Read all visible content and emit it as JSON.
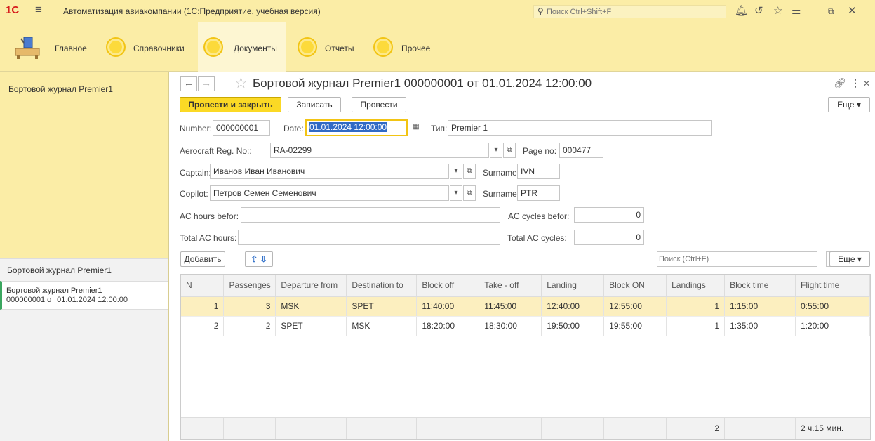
{
  "titlebar": {
    "logo": "1С",
    "app_title": "Автоматизация авиакомпании (1С:Предприятие, учебная версия)",
    "search_placeholder": "Поиск Ctrl+Shift+F"
  },
  "sections": [
    {
      "label": "Главное",
      "icon": "home-desk-icon"
    },
    {
      "label": "Справочники",
      "icon": "circle-icon"
    },
    {
      "label": "Документы",
      "icon": "circle-icon",
      "active": true
    },
    {
      "label": "Отчеты",
      "icon": "circle-icon"
    },
    {
      "label": "Прочее",
      "icon": "circle-icon"
    }
  ],
  "left_panel": {
    "top_item": "Бортовой журнал Premier1",
    "history_title": "Бортовой журнал Premier1",
    "history_item_line1": "Бортовой журнал Premier1",
    "history_item_line2": "000000001 от 01.01.2024 12:00:00"
  },
  "form": {
    "title": "Бортовой журнал Premier1 000000001 от 01.01.2024 12:00:00",
    "buttons": {
      "post_close": "Провести и закрыть",
      "write": "Записать",
      "post": "Провести",
      "more": "Еще ▾"
    },
    "fields": {
      "number_label": "Number:",
      "number": "000000001",
      "date_label": "Date:",
      "date": "01.01.2024 12:00:00",
      "type_label": "Тип:",
      "type": "Premier 1",
      "reg_label": "Aerocraft Reg. No::",
      "reg": "RA-02299",
      "page_label": "Page no:",
      "page": "000477",
      "captain_label": "Captain:",
      "captain": "Иванов Иван Иванович",
      "captain_surname_label": "Surname:",
      "captain_surname": "IVN",
      "copilot_label": "Copilot:",
      "copilot": "Петров Семен Семенович",
      "copilot_surname_label": "Surname:",
      "copilot_surname": "PTR",
      "ac_hours_label": "AC hours befor:",
      "ac_hours": "",
      "ac_cycles_label": "AC cycles befor:",
      "ac_cycles": "0",
      "total_hours_label": "Total AC hours:",
      "total_hours": "",
      "total_cycles_label": "Total AC cycles:",
      "total_cycles": "0"
    },
    "table_toolbar": {
      "add": "Добавить",
      "search_placeholder": "Поиск (Ctrl+F)",
      "more": "Еще ▾"
    },
    "table": {
      "columns": [
        "N",
        "Passenges",
        "Departure from",
        "Destination to",
        "Block off",
        "Take - off",
        "Landing",
        "Block ON",
        "Landings",
        "Block time",
        "Flight time"
      ],
      "rows": [
        [
          "1",
          "3",
          "MSK",
          "SPET",
          "11:40:00",
          "11:45:00",
          "12:40:00",
          "12:55:00",
          "1",
          "1:15:00",
          "0:55:00"
        ],
        [
          "2",
          "2",
          "SPET",
          "MSK",
          "18:20:00",
          "18:30:00",
          "19:50:00",
          "19:55:00",
          "1",
          "1:35:00",
          "1:20:00"
        ]
      ],
      "footer_landings": "2",
      "footer_flight_time": "2 ч.15 мин."
    }
  }
}
